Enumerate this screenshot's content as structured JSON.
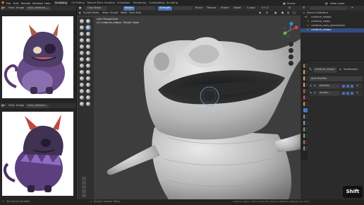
{
  "menu": {
    "file": "File",
    "edit": "Edit",
    "render": "Render",
    "window": "Window",
    "help": "Help",
    "workspaces": [
      "Sculpting",
      "UV Editing",
      "Texture Paint",
      "Shading",
      "Animation",
      "Rendering",
      "Compositing",
      "Scripting"
    ],
    "scene_label": "Scene",
    "view_layer_label": "View Layer"
  },
  "image_editor_top": {
    "view": "View",
    "image": "Image",
    "filename": "cute_creature_..."
  },
  "image_editor_bottom": {
    "view": "View",
    "image": "Image",
    "filename": "cute_creature..."
  },
  "viewport": {
    "mode": "Sculpt Mode",
    "view_menu": "View",
    "sculpt_menu": "Sculpt",
    "mask_menu": "Mask",
    "face_sets_menu": "Face Sets",
    "brush_name": "Clay Strips",
    "radius_label": "Radius",
    "strength_label": "Strength",
    "brush_menu": "Brush",
    "texture_menu": "Texture",
    "stroke_menu": "Stroke",
    "falloff_menu": "Falloff",
    "cursor_menu": "Cursor",
    "symmetry_label": "X Y Z",
    "perspective": "User Perspective",
    "object_info": "(1) creature_retopo : Mouth Open"
  },
  "outliner": {
    "title": "Scene Collection",
    "items": [
      {
        "label": "creature_retopo"
      },
      {
        "label": "creature_claws"
      },
      {
        "label": "creature_eyes_placeholder"
      },
      {
        "label": "creature_retopo"
      }
    ]
  },
  "properties": {
    "object_name": "creature_retopo",
    "modifier_label": "Subdivision",
    "add_modifier": "Add Modifier",
    "modifiers": [
      {
        "label": "Multires"
      },
      {
        "label": "Subdiv..."
      }
    ]
  },
  "status_bar": {
    "left": "Set Active Modifier",
    "mid": "Sculpt Context Menu",
    "right": "creature_retopo | Verts 1,044,234 | Faces 1,045,812 | Objects 1/1 | 3.0.1"
  },
  "key_overlay": "Shift",
  "colors": {
    "accent_blue": "#4772b3",
    "panel": "#303030",
    "viewport_bg": "#3d3d3d",
    "selection_orange": "#f0a030"
  }
}
